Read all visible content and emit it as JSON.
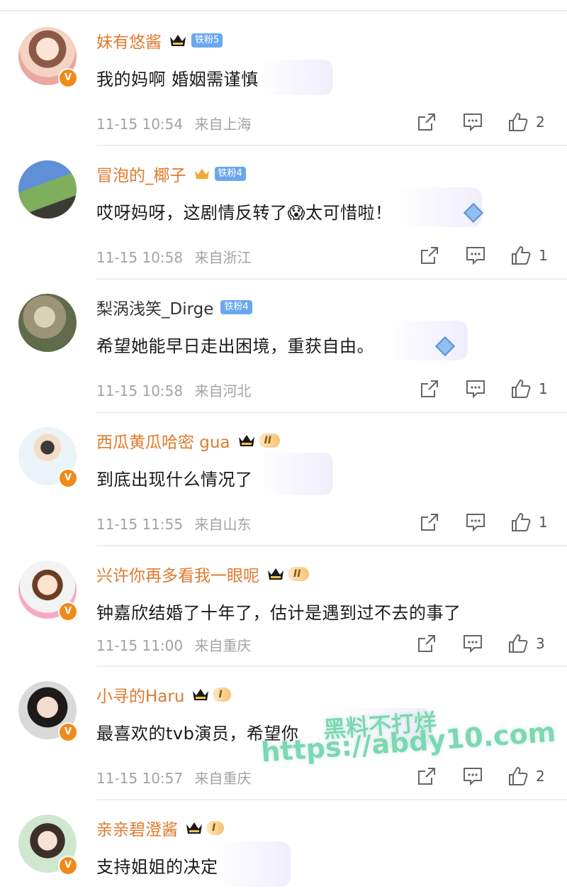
{
  "comments": [
    {
      "username": "妹有悠酱",
      "name_color": "orange",
      "badge_type": "fan",
      "badge_text": "铁粉5",
      "text": "我的妈啊 婚姻需谨慎",
      "date": "11-15 10:54",
      "location": "来自上海",
      "likes": "2",
      "verified": true
    },
    {
      "username": "冒泡的_椰子",
      "name_color": "orange",
      "badge_type": "fan",
      "badge_text": "铁粉4",
      "text": "哎呀妈呀，这剧情反转了😱太可惜啦！",
      "date": "11-15 10:58",
      "location": "来自浙江",
      "likes": "1",
      "verified": false
    },
    {
      "username": "梨涡浅笑_Dirge",
      "name_color": "gray",
      "badge_type": "fan",
      "badge_text": "铁粉4",
      "text": "希望她能早日走出困境，重获自由。",
      "date": "11-15 10:58",
      "location": "来自河北",
      "likes": "1",
      "verified": false
    },
    {
      "username": "西瓜黄瓜哈密 gua",
      "name_color": "orange",
      "badge_type": "level",
      "badge_text": "II",
      "text": "到底出现什么情况了",
      "date": "11-15 11:55",
      "location": "来自山东",
      "likes": "1",
      "verified": true
    },
    {
      "username": "兴许你再多看我一眼呢",
      "name_color": "orange",
      "badge_type": "level",
      "badge_text": "II",
      "text": "钟嘉欣结婚了十年了，估计是遇到过不去的事了",
      "date": "11-15 11:00",
      "location": "来自重庆",
      "likes": "3",
      "verified": true
    },
    {
      "username": "小寻的Haru",
      "name_color": "orange",
      "badge_type": "level",
      "badge_text": "I",
      "text": "最喜欢的tvb演员，希望你",
      "date": "11-15 10:57",
      "location": "来自重庆",
      "likes": "2",
      "verified": true
    },
    {
      "username": "亲亲碧澄酱",
      "name_color": "orange",
      "badge_type": "level",
      "badge_text": "I",
      "text": "支持姐姐的决定",
      "date": "",
      "location": "",
      "likes": "",
      "verified": true
    }
  ],
  "watermark": {
    "line1": "黑料不打烊",
    "line2": "https://abdy10.com"
  },
  "colors": {
    "name_orange": "#e07a2e",
    "meta_gray": "#a3a3a3",
    "verified_badge": "#f08a1c",
    "fan_badge": "#6aa8ee",
    "watermark": "#7bd8b2"
  }
}
